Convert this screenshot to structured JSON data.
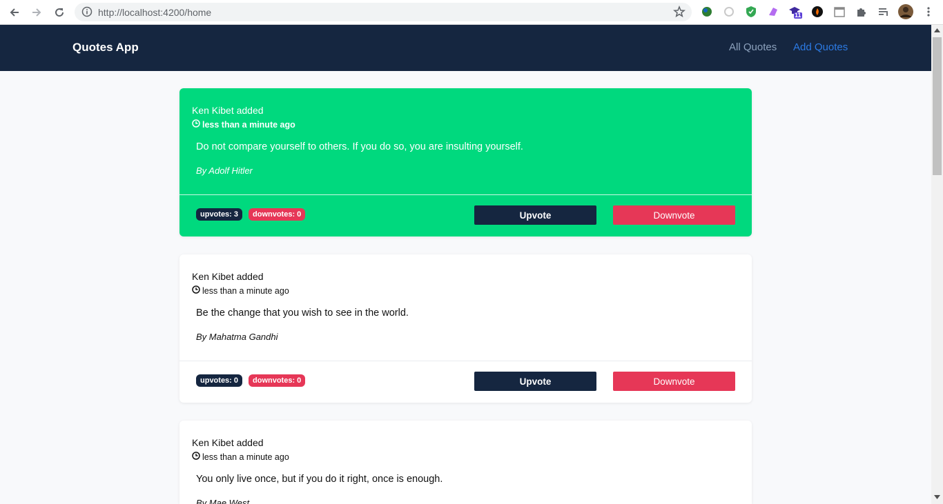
{
  "browser": {
    "url": "http://localhost:4200/home",
    "extension_badge": "11"
  },
  "nav": {
    "brand": "Quotes App",
    "links": [
      {
        "label": "All Quotes",
        "color": "#8da2bd"
      },
      {
        "label": "Add Quotes",
        "color": "#2c7be5"
      }
    ]
  },
  "colors": {
    "navbar": "#152640",
    "highlight_card": "#00d97e",
    "danger": "#e63757"
  },
  "quotes": [
    {
      "adder": "Ken Kibet added",
      "time": "less than a minute ago",
      "text": "Do not compare yourself to others. If you do so, you are insulting yourself.",
      "author": "By Adolf Hitler",
      "upvotes": "upvotes: 3",
      "downvotes": "downvotes: 0",
      "upvote_label": "Upvote",
      "downvote_label": "Downvote",
      "highlighted": true
    },
    {
      "adder": "Ken Kibet added",
      "time": "less than a minute ago",
      "text": "Be the change that you wish to see in the world.",
      "author": "By Mahatma Gandhi",
      "upvotes": "upvotes: 0",
      "downvotes": "downvotes: 0",
      "upvote_label": "Upvote",
      "downvote_label": "Downvote",
      "highlighted": false
    },
    {
      "adder": "Ken Kibet added",
      "time": "less than a minute ago",
      "text": "You only live once, but if you do it right, once is enough.",
      "author": "By Mae West",
      "highlighted": false
    }
  ]
}
